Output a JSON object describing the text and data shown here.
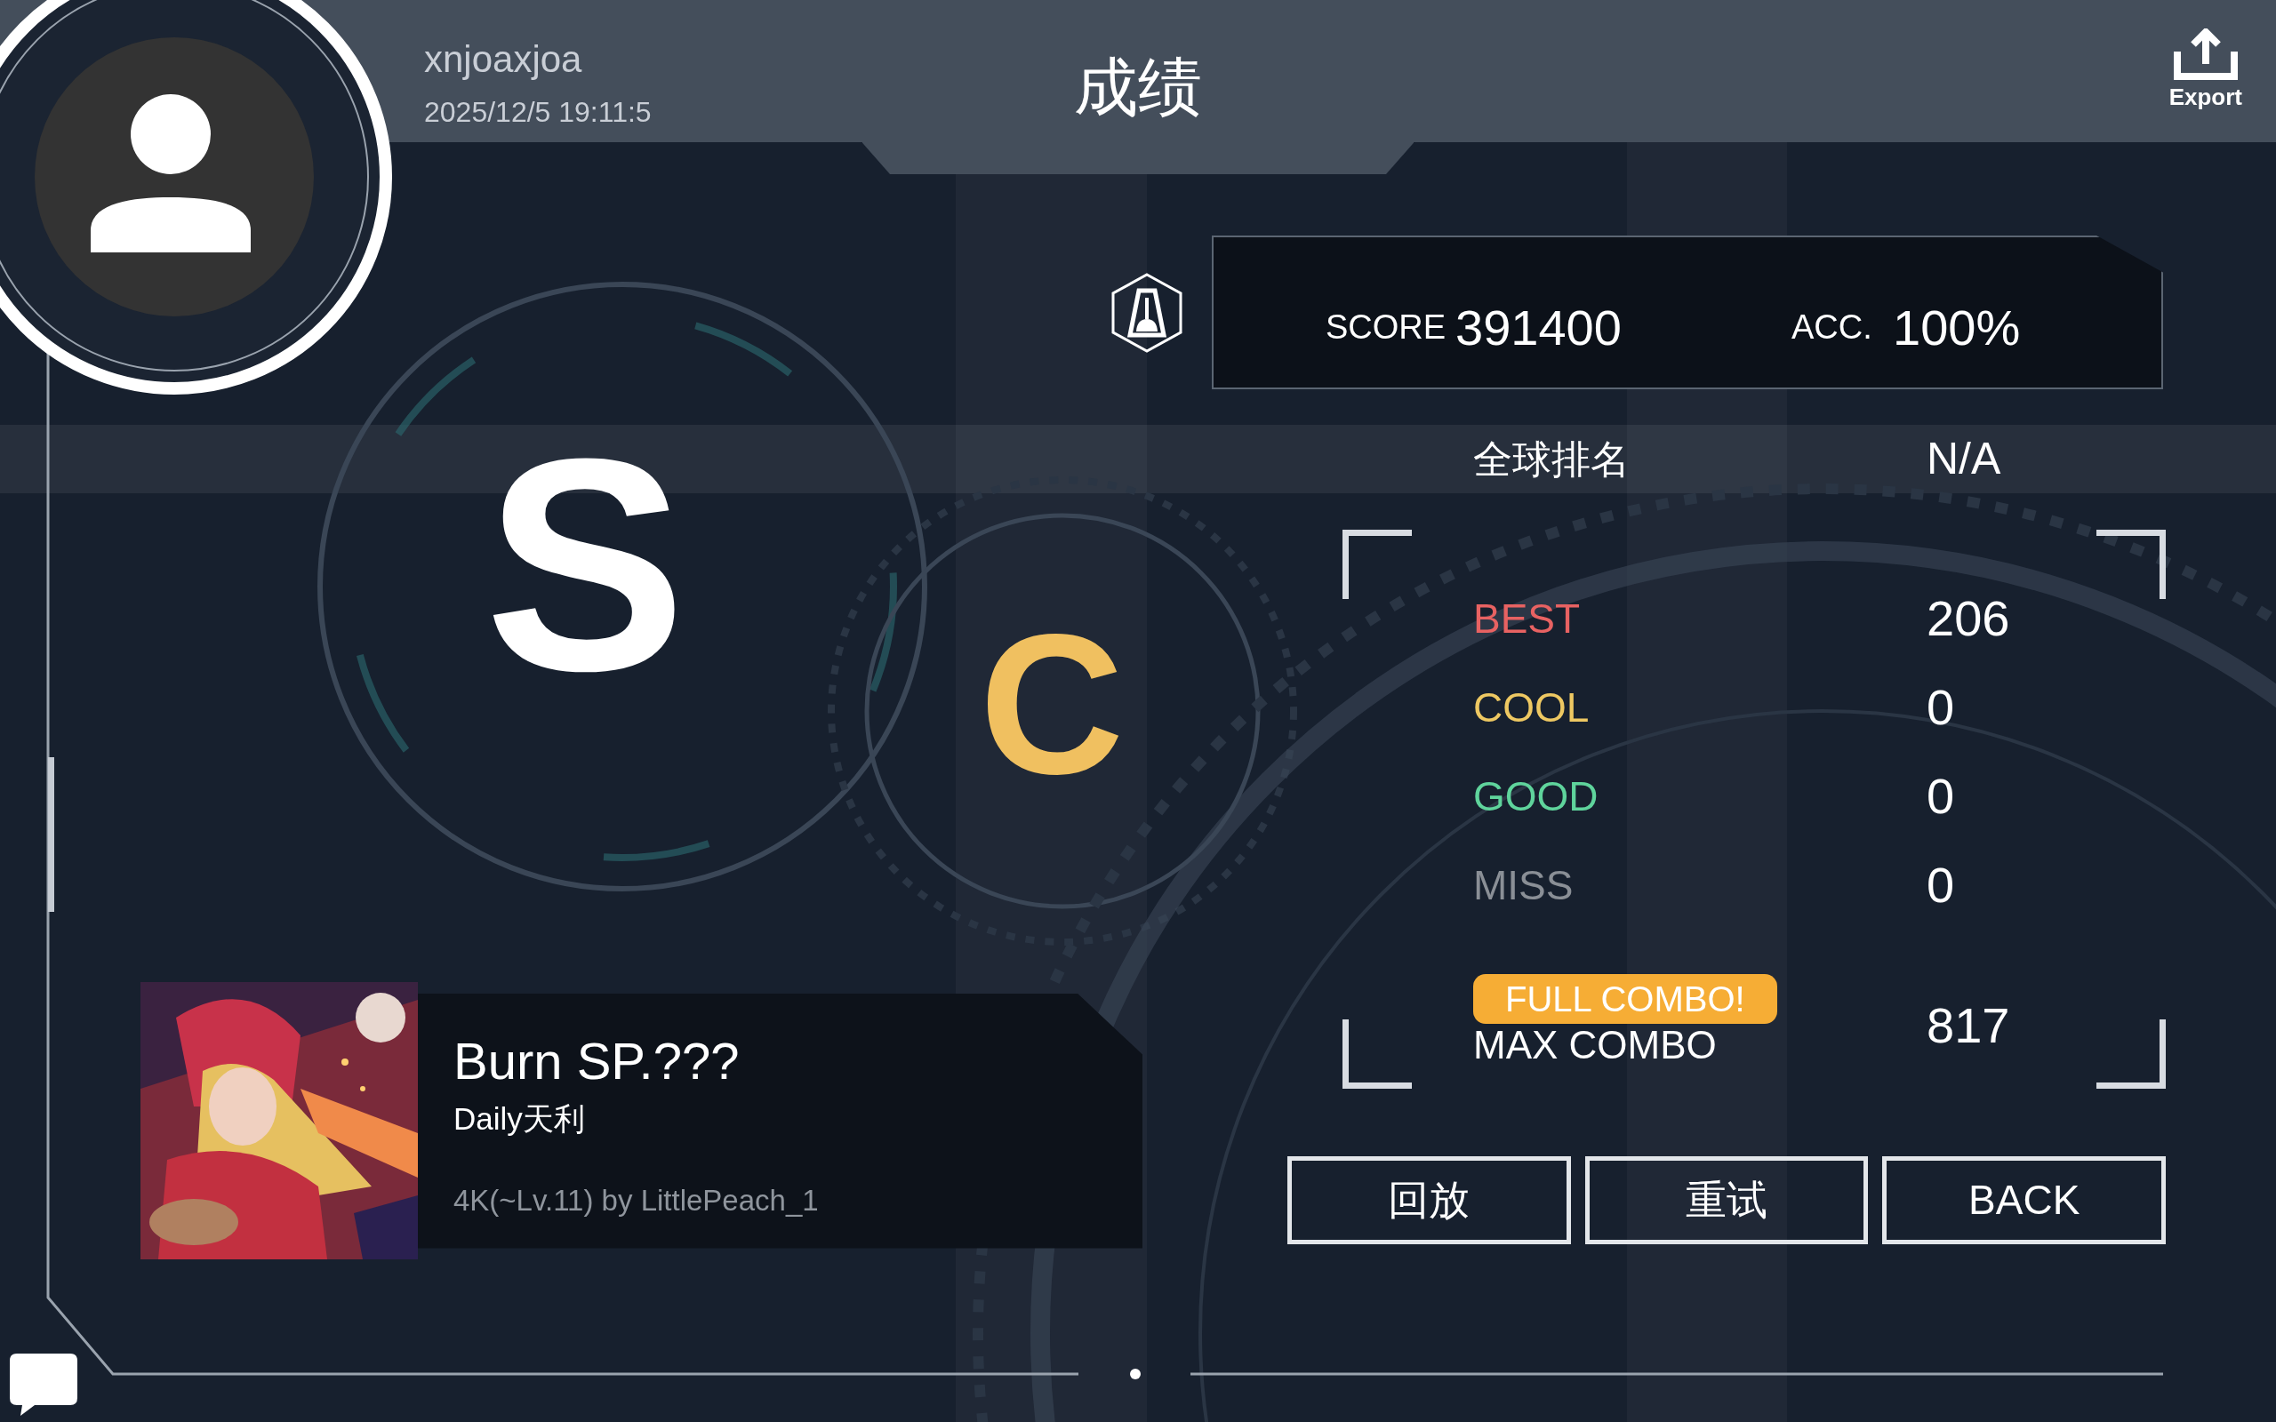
{
  "header": {
    "username": "xnjoaxjoa",
    "timestamp": "2025/12/5 19:11:5",
    "title": "成绩",
    "export_label": "Export"
  },
  "score_panel": {
    "score_label": "SCORE",
    "score": "391400",
    "acc_label": "ACC.",
    "acc": "100%"
  },
  "global_rank": {
    "label": "全球排名",
    "value": "N/A"
  },
  "rank_letters": [
    {
      "text": "S",
      "color": "#ffffff"
    },
    {
      "text": "C",
      "color": "#f0c060"
    }
  ],
  "judgements": [
    {
      "label": "BEST",
      "value": "206",
      "color": "#e86262"
    },
    {
      "label": "COOL",
      "value": "0",
      "color": "#eec862"
    },
    {
      "label": "GOOD",
      "value": "0",
      "color": "#5fd49c"
    },
    {
      "label": "MISS",
      "value": "0",
      "color": "#8a8f96"
    }
  ],
  "max_combo": {
    "full_combo": true,
    "badge": "FULL COMBO!",
    "label": "MAX COMBO",
    "value": "817"
  },
  "buttons": [
    "回放",
    "重试",
    "BACK"
  ],
  "song": {
    "title": "Burn SP.???",
    "artist": "Daily天利",
    "chart": "4K(~Lv.11) by LittlePeach_1"
  }
}
